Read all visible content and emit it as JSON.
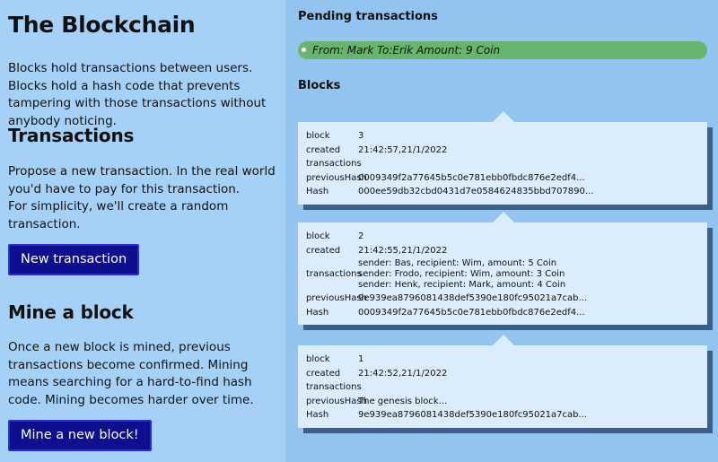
{
  "left": {
    "title": "The Blockchain",
    "intro": "Blocks hold transactions between users. Blocks hold a hash code that prevents tampering with those transactions without anybody noticing.",
    "transactions_heading": "Transactions",
    "transactions_text1": "Propose a new transaction. In the real world you'd have to pay for this transaction.",
    "transactions_text2": "For simplicity, we'll create a random transaction.",
    "new_transaction_label": "New transaction",
    "mine_heading": "Mine a block",
    "mine_text": "Once a new block is mined, previous transactions become confirmed. Mining means searching for a hard-to-find hash code. Mining becomes harder over time.",
    "mine_button_label": "Mine a new block!"
  },
  "right": {
    "pending_heading": "Pending transactions",
    "pending": [
      "From: Mark To:Erik Amount: 9 Coin"
    ],
    "blocks_heading": "Blocks",
    "field_labels": {
      "block": "block",
      "created": "created",
      "transactions": "transactions",
      "previousHash": "previousHash",
      "hash": "Hash"
    },
    "blocks": [
      {
        "block": "3",
        "created": "21:42:57,21/1/2022",
        "transactions": [],
        "previousHash": "0009349f2a77645b5c0e781ebb0fbdc876e2edf4...",
        "hash": "000ee59db32cbd0431d7e0584624835bbd707890..."
      },
      {
        "block": "2",
        "created": "21:42:55,21/1/2022",
        "transactions": [
          "sender: Bas, recipient: Wim, amount: 5 Coin",
          "sender: Frodo, recipient: Wim, amount: 3 Coin",
          "sender: Henk, recipient: Mark, amount: 4 Coin"
        ],
        "previousHash": "9e939ea8796081438def5390e180fc95021a7cab...",
        "hash": "0009349f2a77645b5c0e781ebb0fbdc876e2edf4..."
      },
      {
        "block": "1",
        "created": "21:42:52,21/1/2022",
        "transactions": [],
        "previousHash": "The genesis block...",
        "hash": "9e939ea8796081438def5390e180fc95021a7cab..."
      }
    ]
  }
}
